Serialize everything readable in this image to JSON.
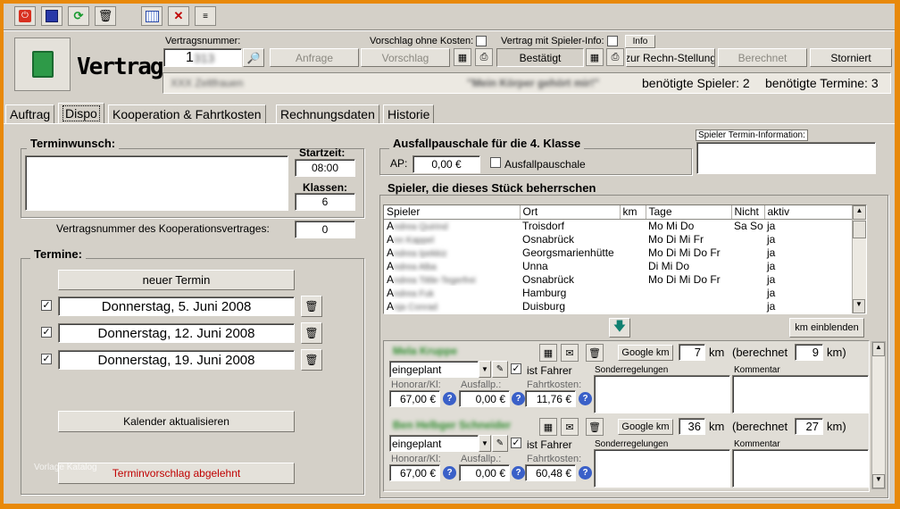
{
  "toolbar": {
    "icons": [
      "power-icon",
      "save-icon",
      "refresh-icon",
      "delete-icon",
      "calendar-icon",
      "calendar-delete-icon",
      "print-list-icon"
    ]
  },
  "header": {
    "title": "Vertrag",
    "contract_no_label": "Vertragsnummer:",
    "contract_no_value": "1",
    "anfrage": "Anfrage",
    "vorschlag_ohne_kosten": "Vorschlag ohne Kosten:",
    "vorschlag": "Vorschlag",
    "vertrag_mit_spieler_info": "Vertrag mit Spieler-Info:",
    "info": "Info",
    "bestaetigt": "Bestätigt",
    "zur_rechn": "zur Rechn-Stellung",
    "berechnet": "Berechnet",
    "storniert": "Storniert",
    "org_name": "XXX Zeltfrauen",
    "play_title": "\"Mein Körper gehört mir!\"",
    "spieler_needed": "benötigte Spieler: 2",
    "termine_needed": "benötigte Termine: 3"
  },
  "tabs": [
    "Auftrag",
    "Dispo",
    "Kooperation & Fahrtkosten",
    "Rechnungsdaten",
    "Historie"
  ],
  "left": {
    "terminwunsch_title": "Terminwunsch:",
    "startzeit_label": "Startzeit:",
    "startzeit_value": "08:00",
    "klassen_label": "Klassen:",
    "klassen_value": "6",
    "koop_label": "Vertragsnummer des Kooperationsvertrages:",
    "koop_value": "0",
    "termine_title": "Termine:",
    "neuer_termin": "neuer Termin",
    "dates": [
      "Donnerstag, 5. Juni 2008",
      "Donnerstag, 12. Juni 2008",
      "Donnerstag, 19. Juni 2008"
    ],
    "kalender": "Kalender aktualisieren",
    "abgelehnt": "Terminvorschlag abgelehnt",
    "abgelehnt_color": "#c00000",
    "watermark": "Vorlage Katalog"
  },
  "ausfall": {
    "title": "Ausfallpauschale für die 4. Klasse",
    "ap_label": "AP:",
    "ap_value": "0,00 €",
    "checkbox_label": "Ausfallpauschale"
  },
  "spieler_info_title": "Spieler Termin-Information:",
  "players": {
    "title": "Spieler, die dieses Stück beherrschen",
    "columns": [
      "Spieler",
      "Ort",
      "km",
      "Tage",
      "Nicht",
      "aktiv"
    ],
    "rows": [
      [
        "A",
        "Troisdorf",
        "",
        "Mo Mi Do",
        "Sa So",
        "ja"
      ],
      [
        "A",
        "Osnabrück",
        "",
        "Mo Di Mi Fr",
        "",
        "ja"
      ],
      [
        "A",
        "Georgsmarienhütte",
        "",
        "Mo Di Mi Do Fr",
        "",
        "ja"
      ],
      [
        "A",
        "Unna",
        "",
        "Di Mi Do",
        "",
        "ja"
      ],
      [
        "A",
        "Osnabrück",
        "",
        "Mo Di Mi Do Fr",
        "",
        "ja"
      ],
      [
        "A",
        "Hamburg",
        "",
        "",
        "",
        "ja"
      ],
      [
        "A",
        "Duisburg",
        "",
        "",
        "",
        "ja"
      ]
    ],
    "blur_names": [
      "ndrea Quirind",
      "nn Kappel",
      "ndrea Ipekkiz",
      "ndrea Alba",
      "ndrea Tittle-Tegerfrei",
      "ndrea Fuk",
      "nja Conrad"
    ],
    "km_einblenden": "km einblenden"
  },
  "assignments": [
    {
      "name": "Mela Kruppe",
      "status": "eingeplant",
      "ist_fahrer": "ist Fahrer",
      "google": "Google km",
      "km": "7",
      "km_unit": "km",
      "berechnet_label": "(berechnet",
      "berechnet_value": "9",
      "berechnet_unit": "km)",
      "sonder": "Sonderregelungen",
      "kommentar": "Kommentar",
      "honorar_label": "Honorar/Kl:",
      "honorar": "67,00 €",
      "ausfall_label": "Ausfallp.:",
      "ausfall": "0,00 €",
      "fahrt_label": "Fahrtkosten:",
      "fahrt": "11,76 €"
    },
    {
      "name": "Ben Helbger Schneider",
      "status": "eingeplant",
      "ist_fahrer": "ist Fahrer",
      "google": "Google km",
      "km": "36",
      "km_unit": "km",
      "berechnet_label": "(berechnet",
      "berechnet_value": "27",
      "berechnet_unit": "km)",
      "sonder": "Sonderregelungen",
      "kommentar": "Kommentar",
      "honorar_label": "Honorar/Kl:",
      "honorar": "67,00 €",
      "ausfall_label": "Ausfallp.:",
      "ausfall": "0,00 €",
      "fahrt_label": "Fahrtkosten:",
      "fahrt": "60,48 €"
    }
  ]
}
